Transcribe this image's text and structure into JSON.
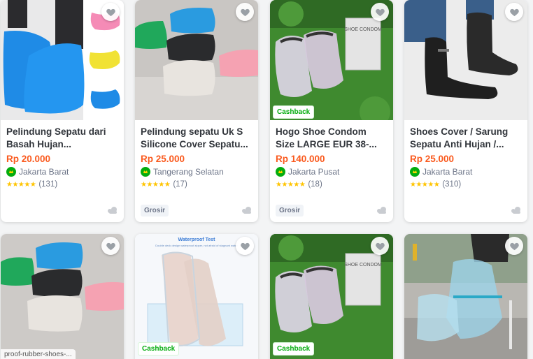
{
  "colors": {
    "price": "#fa591d",
    "cashback": "#03ac0e",
    "star": "#ffc400",
    "title": "#31353b",
    "meta": "#6d7588"
  },
  "products": [
    {
      "title": "Pelindung Sepatu dari Basah Hujan...",
      "price": "Rp 20.000",
      "location": "Jakarta Barat",
      "rating_count": "(131)",
      "stars": "★★★★★",
      "cashback": "",
      "grosir": ""
    },
    {
      "title": "Pelindung sepatu Uk S Silicone Cover Sepatu...",
      "price": "Rp 25.000",
      "location": "Tangerang Selatan",
      "rating_count": "(17)",
      "stars": "★★★★★",
      "cashback": "",
      "grosir": "Grosir"
    },
    {
      "title": "Hogo Shoe Condom Size LARGE EUR 38-...",
      "price": "Rp 140.000",
      "location": "Jakarta Pusat",
      "rating_count": "(18)",
      "stars": "★★★★★",
      "cashback": "Cashback",
      "grosir": "Grosir"
    },
    {
      "title": "Shoes Cover / Sarung Sepatu Anti Hujan /...",
      "price": "Rp 25.000",
      "location": "Jakarta Barat",
      "rating_count": "(310)",
      "stars": "★★★★★",
      "cashback": "",
      "grosir": ""
    }
  ],
  "row2": [
    {
      "cashback": "",
      "slug": "proof-rubber-shoes-..."
    },
    {
      "cashback": "Cashback",
      "overlay_title": "Waterproof Test",
      "overlay_sub": "Double deck design waterproof zipper, not afraid of stagnant water"
    },
    {
      "cashback": "Cashback",
      "box_label": "SHOE CONDOM"
    },
    {
      "cashback": ""
    }
  ],
  "product_box_label": "SHOE CONDOM",
  "icons": {
    "wishlist": "heart-icon",
    "official": "official-store-badge-icon",
    "more": "more-icon"
  }
}
